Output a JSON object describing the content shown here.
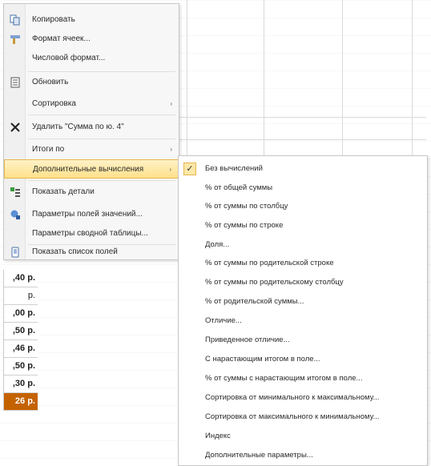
{
  "menu": {
    "items": [
      {
        "label": "Копировать",
        "icon": "copy-icon",
        "arrow": false
      },
      {
        "label": "Формат ячеек...",
        "icon": "format-cells-icon",
        "arrow": false
      },
      {
        "label": "Числовой формат...",
        "icon": "",
        "arrow": false
      },
      {
        "label": "Обновить",
        "icon": "refresh-icon",
        "arrow": false
      },
      {
        "label": "Сортировка",
        "icon": "",
        "arrow": true
      },
      {
        "label": "Удалить \"Сумма по ю. 4\"",
        "icon": "delete-icon",
        "arrow": false
      },
      {
        "label": "Итоги по",
        "icon": "",
        "arrow": true
      },
      {
        "label": "Дополнительные вычисления",
        "icon": "",
        "arrow": true
      },
      {
        "label": "Показать детали",
        "icon": "show-details-icon",
        "arrow": false
      },
      {
        "label": "Параметры полей значений...",
        "icon": "field-settings-icon",
        "arrow": false
      },
      {
        "label": "Параметры сводной таблицы...",
        "icon": "",
        "arrow": false
      },
      {
        "label": "Показать список полей",
        "icon": "field-list-icon",
        "arrow": false
      }
    ],
    "arrow_glyph": "›"
  },
  "submenu": {
    "check_glyph": "✓",
    "items": [
      {
        "label": "Без вычислений",
        "checked": true
      },
      {
        "label": "% от общей суммы"
      },
      {
        "label": "% от суммы по столбцу"
      },
      {
        "label": "% от суммы по строке"
      },
      {
        "label": "Доля..."
      },
      {
        "label": "% от суммы по родительской строке"
      },
      {
        "label": "% от суммы по родительскому столбцу"
      },
      {
        "label": "% от родительской суммы..."
      },
      {
        "label": "Отличие..."
      },
      {
        "label": "Приведенное отличие..."
      },
      {
        "label": "С нарастающим итогом в поле..."
      },
      {
        "label": "% от суммы с нарастающим итогом в поле..."
      },
      {
        "label": "Сортировка от минимального к максимальному..."
      },
      {
        "label": "Сортировка от максимального к минимальному..."
      },
      {
        "label": "Индекс"
      },
      {
        "label": "Дополнительные параметры..."
      }
    ]
  },
  "cells": [
    {
      "value": ",40 р.",
      "selected": false
    },
    {
      "value": "р.",
      "selected": false
    },
    {
      "value": ",00 р.",
      "selected": false
    },
    {
      "value": ",50 р.",
      "selected": false
    },
    {
      "value": ",46 р.",
      "selected": false
    },
    {
      "value": ",50 р.",
      "selected": false
    },
    {
      "value": ",30 р.",
      "selected": false
    },
    {
      "value": "26 р.",
      "selected": true
    }
  ],
  "colors": {
    "highlight": "#ffe08a",
    "selected_cell": "#c46200"
  }
}
